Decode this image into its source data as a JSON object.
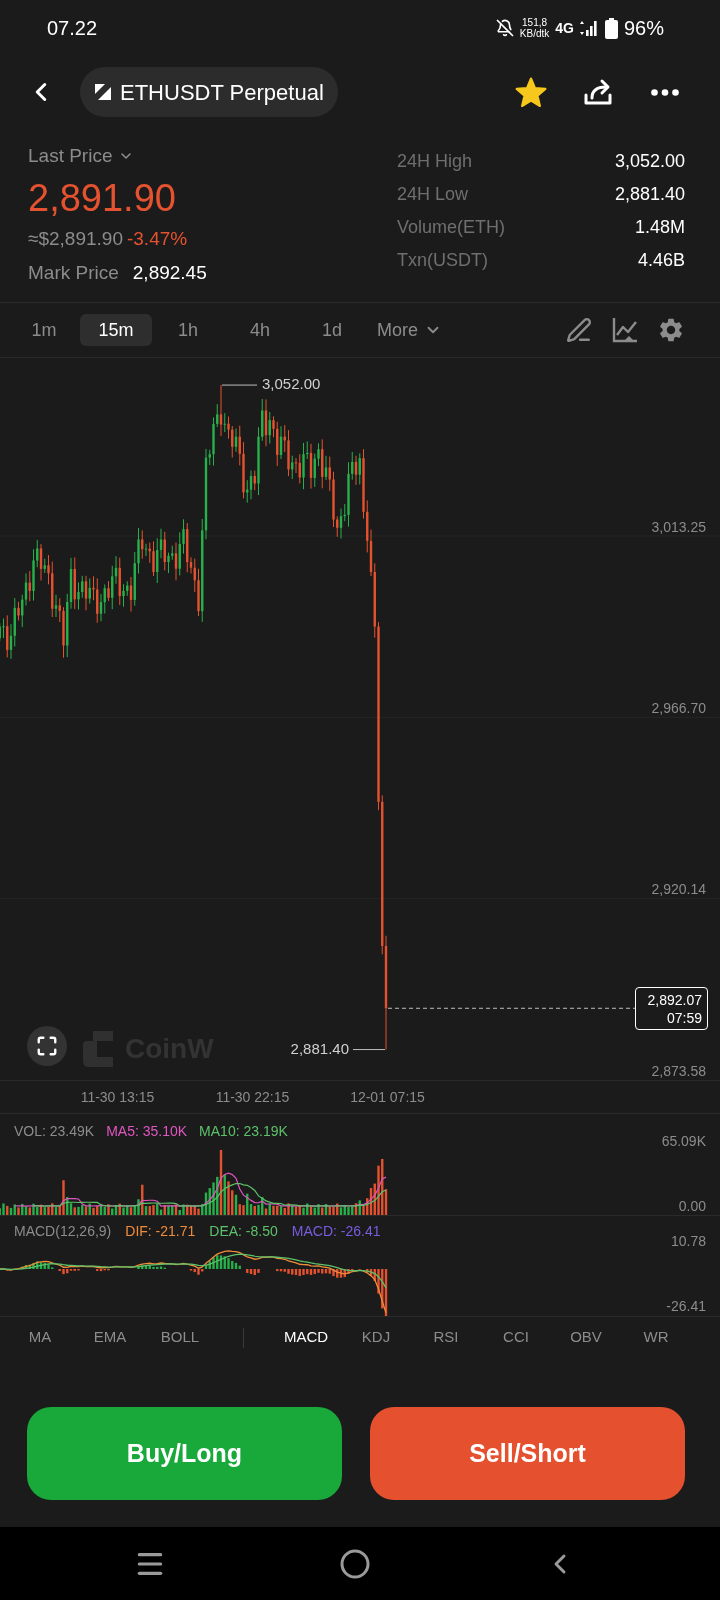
{
  "status_bar": {
    "time": "07.22",
    "net_speed": "151,8",
    "net_speed_unit": "KB/dtk",
    "network": "4G",
    "battery": "96%"
  },
  "header": {
    "title": "ETHUSDT Perpetual",
    "favorite": true
  },
  "price_info": {
    "label": "Last Price",
    "falling": true,
    "last_price": "2,891.90",
    "approx_usd": "≈$2,891.90",
    "change": "-3.47%",
    "mark_price_label": "Mark Price",
    "mark_price": "2,892.45",
    "stats": [
      {
        "label": "24H High",
        "value": "3,052.00"
      },
      {
        "label": "24H Low",
        "value": "2,881.40"
      },
      {
        "label": "Volume(ETH)",
        "value": "1.48M"
      },
      {
        "label": "Txn(USDT)",
        "value": "4.46B"
      }
    ]
  },
  "timeframes": [
    {
      "label": "1m",
      "selected": false
    },
    {
      "label": "15m",
      "selected": true
    },
    {
      "label": "1h",
      "selected": false
    },
    {
      "label": "4h",
      "selected": false
    },
    {
      "label": "1d",
      "selected": false
    }
  ],
  "more_menu": {
    "label": "More"
  },
  "chart": {
    "price_axis": [
      "3,013.25",
      "2,966.70",
      "2,920.14",
      "2,873.58"
    ],
    "high_marker": "3,052.00",
    "low_marker": "2,881.40",
    "last_price_tag": {
      "price": "2,892.07",
      "countdown": "07:59"
    },
    "logo": "CoinW",
    "time_axis": [
      "11-30 13:15",
      "11-30 22:15",
      "12-01 07:15"
    ]
  },
  "volume_panel": {
    "legend": [
      {
        "text": "VOL: 23.49K",
        "color": "#8c8c8c"
      },
      {
        "text": "MA5: 35.10K",
        "color": "#e056c2"
      },
      {
        "text": "MA10: 23.19K",
        "color": "#5cc26a"
      }
    ],
    "axis": [
      "65.09K",
      "0.00"
    ]
  },
  "macd_panel": {
    "legend": [
      {
        "text": "MACD(12,26,9)",
        "color": "#8c8c8c"
      },
      {
        "text": "DIF: -21.71",
        "color": "#f08c3a"
      },
      {
        "text": "DEA: -8.50",
        "color": "#5cc26a"
      },
      {
        "text": "MACD: -26.41",
        "color": "#7a5ce0"
      }
    ],
    "axis": [
      "10.78",
      "-26.41"
    ]
  },
  "main_indicators": [
    {
      "label": "MA",
      "selected": false
    },
    {
      "label": "EMA",
      "selected": false
    },
    {
      "label": "BOLL",
      "selected": false
    }
  ],
  "sub_indicators": [
    {
      "label": "MACD",
      "selected": true
    },
    {
      "label": "KDJ",
      "selected": false
    },
    {
      "label": "RSI",
      "selected": false
    },
    {
      "label": "CCI",
      "selected": false
    },
    {
      "label": "OBV",
      "selected": false
    },
    {
      "label": "WR",
      "selected": false
    }
  ],
  "actions": [
    {
      "label": "Buy/Long",
      "kind": "buy"
    },
    {
      "label": "Sell/Short",
      "kind": "sell"
    }
  ]
}
